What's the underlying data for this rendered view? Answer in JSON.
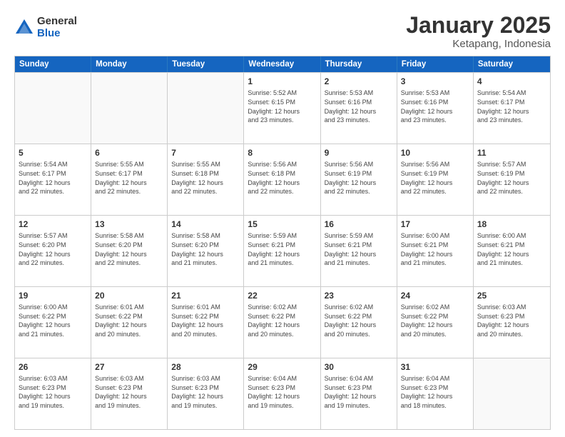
{
  "logo": {
    "general": "General",
    "blue": "Blue"
  },
  "title": "January 2025",
  "location": "Ketapang, Indonesia",
  "days": [
    "Sunday",
    "Monday",
    "Tuesday",
    "Wednesday",
    "Thursday",
    "Friday",
    "Saturday"
  ],
  "weeks": [
    [
      {
        "day": "",
        "info": ""
      },
      {
        "day": "",
        "info": ""
      },
      {
        "day": "",
        "info": ""
      },
      {
        "day": "1",
        "info": "Sunrise: 5:52 AM\nSunset: 6:15 PM\nDaylight: 12 hours\nand 23 minutes."
      },
      {
        "day": "2",
        "info": "Sunrise: 5:53 AM\nSunset: 6:16 PM\nDaylight: 12 hours\nand 23 minutes."
      },
      {
        "day": "3",
        "info": "Sunrise: 5:53 AM\nSunset: 6:16 PM\nDaylight: 12 hours\nand 23 minutes."
      },
      {
        "day": "4",
        "info": "Sunrise: 5:54 AM\nSunset: 6:17 PM\nDaylight: 12 hours\nand 23 minutes."
      }
    ],
    [
      {
        "day": "5",
        "info": "Sunrise: 5:54 AM\nSunset: 6:17 PM\nDaylight: 12 hours\nand 22 minutes."
      },
      {
        "day": "6",
        "info": "Sunrise: 5:55 AM\nSunset: 6:17 PM\nDaylight: 12 hours\nand 22 minutes."
      },
      {
        "day": "7",
        "info": "Sunrise: 5:55 AM\nSunset: 6:18 PM\nDaylight: 12 hours\nand 22 minutes."
      },
      {
        "day": "8",
        "info": "Sunrise: 5:56 AM\nSunset: 6:18 PM\nDaylight: 12 hours\nand 22 minutes."
      },
      {
        "day": "9",
        "info": "Sunrise: 5:56 AM\nSunset: 6:19 PM\nDaylight: 12 hours\nand 22 minutes."
      },
      {
        "day": "10",
        "info": "Sunrise: 5:56 AM\nSunset: 6:19 PM\nDaylight: 12 hours\nand 22 minutes."
      },
      {
        "day": "11",
        "info": "Sunrise: 5:57 AM\nSunset: 6:19 PM\nDaylight: 12 hours\nand 22 minutes."
      }
    ],
    [
      {
        "day": "12",
        "info": "Sunrise: 5:57 AM\nSunset: 6:20 PM\nDaylight: 12 hours\nand 22 minutes."
      },
      {
        "day": "13",
        "info": "Sunrise: 5:58 AM\nSunset: 6:20 PM\nDaylight: 12 hours\nand 22 minutes."
      },
      {
        "day": "14",
        "info": "Sunrise: 5:58 AM\nSunset: 6:20 PM\nDaylight: 12 hours\nand 21 minutes."
      },
      {
        "day": "15",
        "info": "Sunrise: 5:59 AM\nSunset: 6:21 PM\nDaylight: 12 hours\nand 21 minutes."
      },
      {
        "day": "16",
        "info": "Sunrise: 5:59 AM\nSunset: 6:21 PM\nDaylight: 12 hours\nand 21 minutes."
      },
      {
        "day": "17",
        "info": "Sunrise: 6:00 AM\nSunset: 6:21 PM\nDaylight: 12 hours\nand 21 minutes."
      },
      {
        "day": "18",
        "info": "Sunrise: 6:00 AM\nSunset: 6:21 PM\nDaylight: 12 hours\nand 21 minutes."
      }
    ],
    [
      {
        "day": "19",
        "info": "Sunrise: 6:00 AM\nSunset: 6:22 PM\nDaylight: 12 hours\nand 21 minutes."
      },
      {
        "day": "20",
        "info": "Sunrise: 6:01 AM\nSunset: 6:22 PM\nDaylight: 12 hours\nand 20 minutes."
      },
      {
        "day": "21",
        "info": "Sunrise: 6:01 AM\nSunset: 6:22 PM\nDaylight: 12 hours\nand 20 minutes."
      },
      {
        "day": "22",
        "info": "Sunrise: 6:02 AM\nSunset: 6:22 PM\nDaylight: 12 hours\nand 20 minutes."
      },
      {
        "day": "23",
        "info": "Sunrise: 6:02 AM\nSunset: 6:22 PM\nDaylight: 12 hours\nand 20 minutes."
      },
      {
        "day": "24",
        "info": "Sunrise: 6:02 AM\nSunset: 6:22 PM\nDaylight: 12 hours\nand 20 minutes."
      },
      {
        "day": "25",
        "info": "Sunrise: 6:03 AM\nSunset: 6:23 PM\nDaylight: 12 hours\nand 20 minutes."
      }
    ],
    [
      {
        "day": "26",
        "info": "Sunrise: 6:03 AM\nSunset: 6:23 PM\nDaylight: 12 hours\nand 19 minutes."
      },
      {
        "day": "27",
        "info": "Sunrise: 6:03 AM\nSunset: 6:23 PM\nDaylight: 12 hours\nand 19 minutes."
      },
      {
        "day": "28",
        "info": "Sunrise: 6:03 AM\nSunset: 6:23 PM\nDaylight: 12 hours\nand 19 minutes."
      },
      {
        "day": "29",
        "info": "Sunrise: 6:04 AM\nSunset: 6:23 PM\nDaylight: 12 hours\nand 19 minutes."
      },
      {
        "day": "30",
        "info": "Sunrise: 6:04 AM\nSunset: 6:23 PM\nDaylight: 12 hours\nand 19 minutes."
      },
      {
        "day": "31",
        "info": "Sunrise: 6:04 AM\nSunset: 6:23 PM\nDaylight: 12 hours\nand 18 minutes."
      },
      {
        "day": "",
        "info": ""
      }
    ]
  ]
}
